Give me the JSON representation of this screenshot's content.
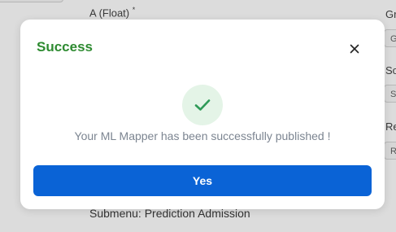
{
  "background": {
    "field_label": "A  (Float)",
    "required_mark": "*",
    "right_labels": [
      "Gr",
      "So",
      "Re"
    ],
    "right_boxes": [
      "G",
      "S",
      "R"
    ],
    "submenu_text": "Submenu: Prediction Admission"
  },
  "modal": {
    "title": "Success",
    "close_icon": "close-icon",
    "status_icon": "check-icon",
    "message": "Your ML Mapper has been successfully published !",
    "confirm_label": "Yes"
  },
  "colors": {
    "title": "#2e8b31",
    "check": "#2e9a57",
    "check_bg": "#e4f4e7",
    "message": "#7c8591",
    "button": "#0a63d6",
    "overlay": "#dcdcdc"
  }
}
